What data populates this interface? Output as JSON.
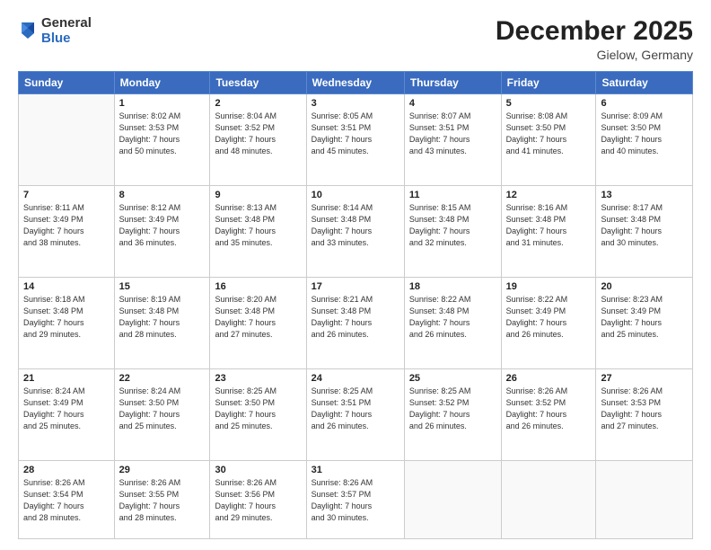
{
  "header": {
    "logo_general": "General",
    "logo_blue": "Blue",
    "title": "December 2025",
    "subtitle": "Gielow, Germany"
  },
  "calendar": {
    "days_of_week": [
      "Sunday",
      "Monday",
      "Tuesday",
      "Wednesday",
      "Thursday",
      "Friday",
      "Saturday"
    ],
    "weeks": [
      [
        {
          "day": "",
          "info": ""
        },
        {
          "day": "1",
          "info": "Sunrise: 8:02 AM\nSunset: 3:53 PM\nDaylight: 7 hours\nand 50 minutes."
        },
        {
          "day": "2",
          "info": "Sunrise: 8:04 AM\nSunset: 3:52 PM\nDaylight: 7 hours\nand 48 minutes."
        },
        {
          "day": "3",
          "info": "Sunrise: 8:05 AM\nSunset: 3:51 PM\nDaylight: 7 hours\nand 45 minutes."
        },
        {
          "day": "4",
          "info": "Sunrise: 8:07 AM\nSunset: 3:51 PM\nDaylight: 7 hours\nand 43 minutes."
        },
        {
          "day": "5",
          "info": "Sunrise: 8:08 AM\nSunset: 3:50 PM\nDaylight: 7 hours\nand 41 minutes."
        },
        {
          "day": "6",
          "info": "Sunrise: 8:09 AM\nSunset: 3:50 PM\nDaylight: 7 hours\nand 40 minutes."
        }
      ],
      [
        {
          "day": "7",
          "info": "Sunrise: 8:11 AM\nSunset: 3:49 PM\nDaylight: 7 hours\nand 38 minutes."
        },
        {
          "day": "8",
          "info": "Sunrise: 8:12 AM\nSunset: 3:49 PM\nDaylight: 7 hours\nand 36 minutes."
        },
        {
          "day": "9",
          "info": "Sunrise: 8:13 AM\nSunset: 3:48 PM\nDaylight: 7 hours\nand 35 minutes."
        },
        {
          "day": "10",
          "info": "Sunrise: 8:14 AM\nSunset: 3:48 PM\nDaylight: 7 hours\nand 33 minutes."
        },
        {
          "day": "11",
          "info": "Sunrise: 8:15 AM\nSunset: 3:48 PM\nDaylight: 7 hours\nand 32 minutes."
        },
        {
          "day": "12",
          "info": "Sunrise: 8:16 AM\nSunset: 3:48 PM\nDaylight: 7 hours\nand 31 minutes."
        },
        {
          "day": "13",
          "info": "Sunrise: 8:17 AM\nSunset: 3:48 PM\nDaylight: 7 hours\nand 30 minutes."
        }
      ],
      [
        {
          "day": "14",
          "info": "Sunrise: 8:18 AM\nSunset: 3:48 PM\nDaylight: 7 hours\nand 29 minutes."
        },
        {
          "day": "15",
          "info": "Sunrise: 8:19 AM\nSunset: 3:48 PM\nDaylight: 7 hours\nand 28 minutes."
        },
        {
          "day": "16",
          "info": "Sunrise: 8:20 AM\nSunset: 3:48 PM\nDaylight: 7 hours\nand 27 minutes."
        },
        {
          "day": "17",
          "info": "Sunrise: 8:21 AM\nSunset: 3:48 PM\nDaylight: 7 hours\nand 26 minutes."
        },
        {
          "day": "18",
          "info": "Sunrise: 8:22 AM\nSunset: 3:48 PM\nDaylight: 7 hours\nand 26 minutes."
        },
        {
          "day": "19",
          "info": "Sunrise: 8:22 AM\nSunset: 3:49 PM\nDaylight: 7 hours\nand 26 minutes."
        },
        {
          "day": "20",
          "info": "Sunrise: 8:23 AM\nSunset: 3:49 PM\nDaylight: 7 hours\nand 25 minutes."
        }
      ],
      [
        {
          "day": "21",
          "info": "Sunrise: 8:24 AM\nSunset: 3:49 PM\nDaylight: 7 hours\nand 25 minutes."
        },
        {
          "day": "22",
          "info": "Sunrise: 8:24 AM\nSunset: 3:50 PM\nDaylight: 7 hours\nand 25 minutes."
        },
        {
          "day": "23",
          "info": "Sunrise: 8:25 AM\nSunset: 3:50 PM\nDaylight: 7 hours\nand 25 minutes."
        },
        {
          "day": "24",
          "info": "Sunrise: 8:25 AM\nSunset: 3:51 PM\nDaylight: 7 hours\nand 26 minutes."
        },
        {
          "day": "25",
          "info": "Sunrise: 8:25 AM\nSunset: 3:52 PM\nDaylight: 7 hours\nand 26 minutes."
        },
        {
          "day": "26",
          "info": "Sunrise: 8:26 AM\nSunset: 3:52 PM\nDaylight: 7 hours\nand 26 minutes."
        },
        {
          "day": "27",
          "info": "Sunrise: 8:26 AM\nSunset: 3:53 PM\nDaylight: 7 hours\nand 27 minutes."
        }
      ],
      [
        {
          "day": "28",
          "info": "Sunrise: 8:26 AM\nSunset: 3:54 PM\nDaylight: 7 hours\nand 28 minutes."
        },
        {
          "day": "29",
          "info": "Sunrise: 8:26 AM\nSunset: 3:55 PM\nDaylight: 7 hours\nand 28 minutes."
        },
        {
          "day": "30",
          "info": "Sunrise: 8:26 AM\nSunset: 3:56 PM\nDaylight: 7 hours\nand 29 minutes."
        },
        {
          "day": "31",
          "info": "Sunrise: 8:26 AM\nSunset: 3:57 PM\nDaylight: 7 hours\nand 30 minutes."
        },
        {
          "day": "",
          "info": ""
        },
        {
          "day": "",
          "info": ""
        },
        {
          "day": "",
          "info": ""
        }
      ]
    ]
  }
}
